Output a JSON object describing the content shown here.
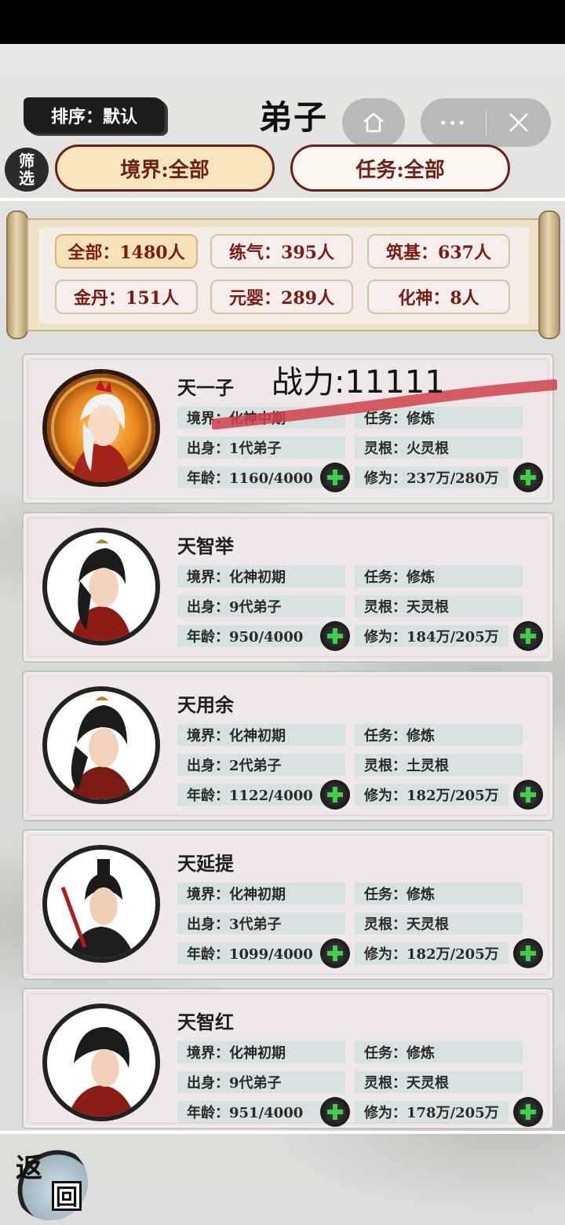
{
  "header": {
    "sort_label": "排序：默认",
    "title": "弟子",
    "filter_label_top": "筛",
    "filter_label_bottom": "选",
    "realm_filter": "境界:全部",
    "task_filter": "任务:全部",
    "menu_dots": "···"
  },
  "stats": [
    {
      "label": "全部：1480人",
      "active": true
    },
    {
      "label": "练气：395人",
      "active": false
    },
    {
      "label": "筑基：637人",
      "active": false
    },
    {
      "label": "金丹：151人",
      "active": false
    },
    {
      "label": "元婴：289人",
      "active": false
    },
    {
      "label": "化神：8人",
      "active": false
    }
  ],
  "power_overlay": "战力:11111",
  "disciples": [
    {
      "name": "天一子",
      "realm": "境界：化神中期",
      "task": "任务：修炼",
      "origin": "出身：1代弟子",
      "root": "灵根：火灵根",
      "age": "年龄：1160/4000",
      "cultivation": "修为：237万/280万"
    },
    {
      "name": "天智举",
      "realm": "境界：化神初期",
      "task": "任务：修炼",
      "origin": "出身：9代弟子",
      "root": "灵根：天灵根",
      "age": "年龄：950/4000",
      "cultivation": "修为：184万/205万"
    },
    {
      "name": "天用余",
      "realm": "境界：化神初期",
      "task": "任务：修炼",
      "origin": "出身：2代弟子",
      "root": "灵根：土灵根",
      "age": "年龄：1122/4000",
      "cultivation": "修为：182万/205万"
    },
    {
      "name": "天延提",
      "realm": "境界：化神初期",
      "task": "任务：修炼",
      "origin": "出身：3代弟子",
      "root": "灵根：天灵根",
      "age": "年龄：1099/4000",
      "cultivation": "修为：182万/205万"
    },
    {
      "name": "天智红",
      "realm": "境界：化神初期",
      "task": "任务：修炼",
      "origin": "出身：9代弟子",
      "root": "灵根：天灵根",
      "age": "年龄：951/4000",
      "cultivation": "修为：178万/205万"
    }
  ],
  "footer": {
    "back_top": "返",
    "back_bottom": "回"
  },
  "colors": {
    "accent": "#6e1f17",
    "field_bg": "#d6e2e2",
    "plus_green": "#3fcf4a"
  }
}
